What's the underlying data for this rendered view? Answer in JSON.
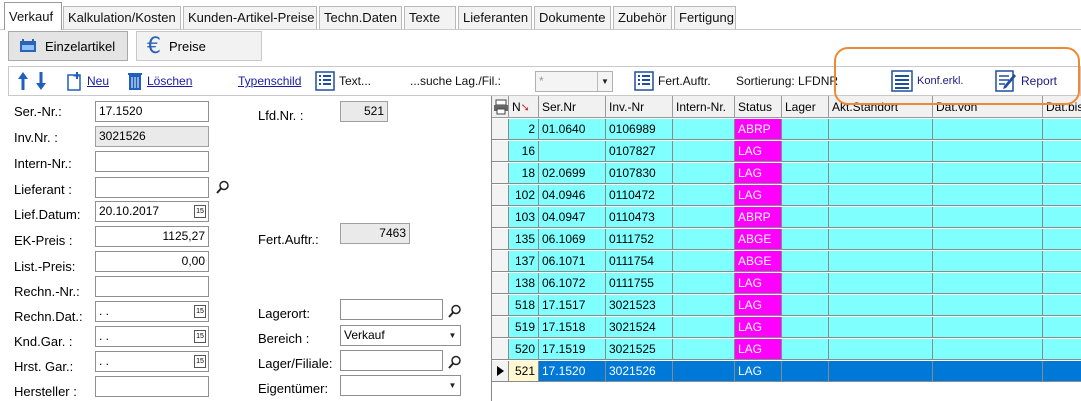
{
  "tabs": [
    "Verkauf",
    "Kalkulation/Kosten",
    "Kunden-Artikel-Preise",
    "Techn.Daten",
    "Texte",
    "Lieferanten",
    "Dokumente",
    "Zubehör",
    "Fertigung"
  ],
  "subtabs": [
    "Einzelartikel",
    "Preise"
  ],
  "toolbar": {
    "neu": "Neu",
    "loeschen": "Löschen",
    "typenschild": "Typenschild",
    "text": "Text...",
    "suche": "...suche",
    "lagfil_label": "Lag./Fil.:",
    "lagfil_value": "*",
    "fert_auftr": "Fert.Auftr.",
    "sortierung": "Sortierung: LFDNR",
    "konf_erkl": "Konf.erkl.",
    "report": "Report"
  },
  "form": {
    "ser_nr_label": "Ser.-Nr.:",
    "ser_nr": "17.1520",
    "inv_nr_label": "Inv.Nr. :",
    "inv_nr": "3021526",
    "intern_nr_label": "Intern-Nr.:",
    "intern_nr": "",
    "lieferant_label": "Lieferant :",
    "lieferant": "",
    "lief_datum_label": "Lief.Datum:",
    "lief_datum": "20.10.2017",
    "ek_preis_label": "EK-Preis :",
    "ek_preis": "1125,27",
    "list_preis_label": "List.-Preis:",
    "list_preis": "0,00",
    "rechn_nr_label": "Rechn.-Nr.:",
    "rechn_nr": "",
    "rechn_dat_label": "Rechn.Dat.:",
    "rechn_dat": " .  .",
    "knd_gar_label": "Knd.Gar. :",
    "knd_gar": " .  .",
    "hrst_gar_label": "Hrst. Gar.:",
    "hrst_gar": " .  .",
    "hersteller_label": "Hersteller :",
    "hersteller": "",
    "lfd_nr_label": "Lfd.Nr. :",
    "lfd_nr": "521",
    "fert_auftr_label": "Fert.Auftr.:",
    "fert_auftr": "7463",
    "lagerort_label": "Lagerort:",
    "lagerort": "",
    "bereich_label": "Bereich :",
    "bereich": "Verkauf",
    "lager_filiale_label": "Lager/Filiale:",
    "lager_filiale": "",
    "eigentuemer_label": "Eigentümer:",
    "eigentuemer": ""
  },
  "grid": {
    "columns": [
      "N",
      "Ser.Nr",
      "Inv.-Nr",
      "Intern-Nr.",
      "Status",
      "Lager",
      "Akt.Standort",
      "Dat.von",
      "Dat.bis"
    ],
    "rows": [
      {
        "n": "2",
        "ser": "01.0640",
        "inv": "0106989",
        "status": "ABRP"
      },
      {
        "n": "16",
        "ser": "",
        "inv": "0107827",
        "status": "LAG"
      },
      {
        "n": "18",
        "ser": "02.0699",
        "inv": "0107830",
        "status": "LAG"
      },
      {
        "n": "102",
        "ser": "04.0946",
        "inv": "0110472",
        "status": "LAG"
      },
      {
        "n": "103",
        "ser": "04.0947",
        "inv": "0110473",
        "status": "ABRP"
      },
      {
        "n": "135",
        "ser": "06.1069",
        "inv": "0111752",
        "status": "ABGE"
      },
      {
        "n": "137",
        "ser": "06.1071",
        "inv": "0111754",
        "status": "ABGE"
      },
      {
        "n": "138",
        "ser": "06.1072",
        "inv": "0111755",
        "status": "LAG"
      },
      {
        "n": "518",
        "ser": "17.1517",
        "inv": "3021523",
        "status": "LAG"
      },
      {
        "n": "519",
        "ser": "17.1518",
        "inv": "3021524",
        "status": "LAG"
      },
      {
        "n": "520",
        "ser": "17.1519",
        "inv": "3021525",
        "status": "LAG"
      },
      {
        "n": "521",
        "ser": "17.1520",
        "inv": "3021526",
        "status": "LAG",
        "selected": true
      }
    ]
  },
  "colors": {
    "cyan": "#80ffff",
    "magenta": "#ff00ff",
    "selection": "#0078d7",
    "annotation": "#ee8a35"
  }
}
